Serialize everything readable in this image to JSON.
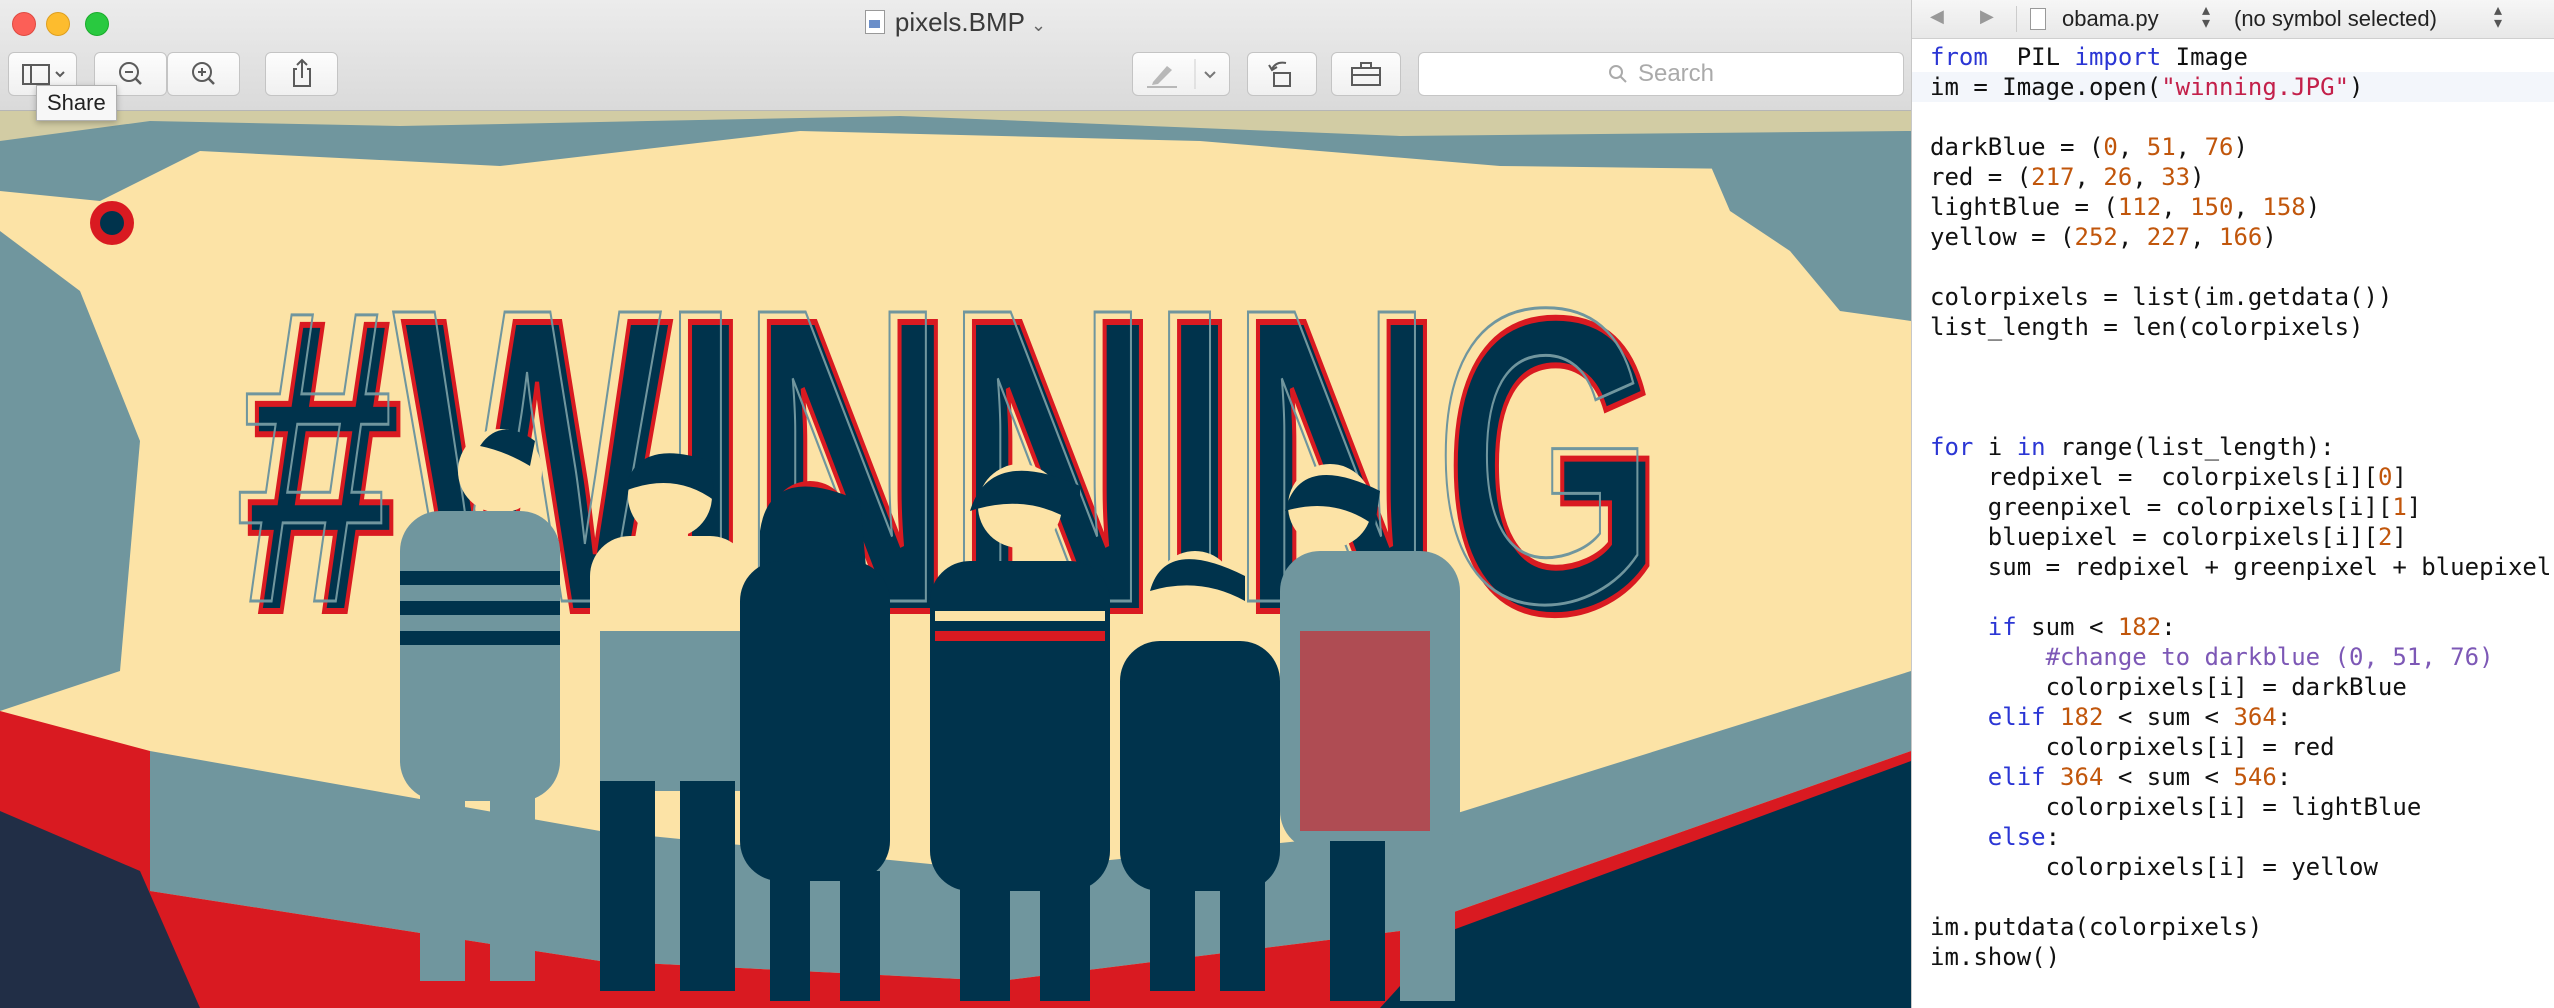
{
  "preview": {
    "title": "pixels.BMP",
    "tooltip": "Share",
    "search_placeholder": "Search",
    "image_text": "#WINNING",
    "palette": {
      "darkBlue": "#00334c",
      "red": "#d91a21",
      "lightBlue": "#70969e",
      "yellow": "#fce3a6"
    }
  },
  "editor": {
    "file_name": "obama.py",
    "symbol": "(no symbol selected)",
    "code_lines": [
      [
        [
          "kw",
          "from"
        ],
        [
          "",
          "  PIL "
        ],
        [
          "kw",
          "import"
        ],
        [
          "",
          " Image"
        ]
      ],
      [
        [
          "",
          "im = Image.open("
        ],
        [
          "str",
          "\"winning.JPG\""
        ],
        [
          "",
          ")"
        ]
      ],
      [],
      [
        [
          "",
          "darkBlue = ("
        ],
        [
          "num",
          "0"
        ],
        [
          "",
          ", "
        ],
        [
          "num",
          "51"
        ],
        [
          "",
          ", "
        ],
        [
          "num",
          "76"
        ],
        [
          "",
          ")"
        ]
      ],
      [
        [
          "",
          "red = ("
        ],
        [
          "num",
          "217"
        ],
        [
          "",
          ", "
        ],
        [
          "num",
          "26"
        ],
        [
          "",
          ", "
        ],
        [
          "num",
          "33"
        ],
        [
          "",
          ")"
        ]
      ],
      [
        [
          "",
          "lightBlue = ("
        ],
        [
          "num",
          "112"
        ],
        [
          "",
          ", "
        ],
        [
          "num",
          "150"
        ],
        [
          "",
          ", "
        ],
        [
          "num",
          "158"
        ],
        [
          "",
          ")"
        ]
      ],
      [
        [
          "",
          "yellow = ("
        ],
        [
          "num",
          "252"
        ],
        [
          "",
          ", "
        ],
        [
          "num",
          "227"
        ],
        [
          "",
          ", "
        ],
        [
          "num",
          "166"
        ],
        [
          "",
          ")"
        ]
      ],
      [],
      [
        [
          "",
          "colorpixels = list(im.getdata())"
        ]
      ],
      [
        [
          "",
          "list_length = len(colorpixels)"
        ]
      ],
      [],
      [],
      [],
      [
        [
          "kw",
          "for"
        ],
        [
          "",
          " i "
        ],
        [
          "kw",
          "in"
        ],
        [
          "",
          " range(list_length):"
        ]
      ],
      [
        [
          "",
          "    redpixel =  colorpixels[i]["
        ],
        [
          "num",
          "0"
        ],
        [
          "",
          "]"
        ]
      ],
      [
        [
          "",
          "    greenpixel = colorpixels[i]["
        ],
        [
          "num",
          "1"
        ],
        [
          "",
          "]"
        ]
      ],
      [
        [
          "",
          "    bluepixel = colorpixels[i]["
        ],
        [
          "num",
          "2"
        ],
        [
          "",
          "]"
        ]
      ],
      [
        [
          "",
          "    sum = redpixel + greenpixel + bluepixel"
        ]
      ],
      [],
      [
        [
          "",
          "    "
        ],
        [
          "kw",
          "if"
        ],
        [
          "",
          " sum < "
        ],
        [
          "num",
          "182"
        ],
        [
          "",
          ":"
        ]
      ],
      [
        [
          "",
          "        "
        ],
        [
          "cmt",
          "#change to darkblue (0, 51, 76)"
        ]
      ],
      [
        [
          "",
          "        colorpixels[i] = darkBlue"
        ]
      ],
      [
        [
          "",
          "    "
        ],
        [
          "kw",
          "elif"
        ],
        [
          " ",
          " "
        ],
        [
          "num",
          "182"
        ],
        [
          "",
          " < sum < "
        ],
        [
          "num",
          "364"
        ],
        [
          "",
          ":"
        ]
      ],
      [
        [
          "",
          "        colorpixels[i] = red"
        ]
      ],
      [
        [
          "",
          "    "
        ],
        [
          "kw",
          "elif"
        ],
        [
          "",
          " "
        ],
        [
          "num",
          "364"
        ],
        [
          "",
          " < sum < "
        ],
        [
          "num",
          "546"
        ],
        [
          "",
          ":"
        ]
      ],
      [
        [
          "",
          "        colorpixels[i] = lightBlue"
        ]
      ],
      [
        [
          "",
          "    "
        ],
        [
          "kw",
          "else"
        ],
        [
          "",
          ":"
        ]
      ],
      [
        [
          "",
          "        colorpixels[i] = yellow"
        ]
      ],
      [],
      [
        [
          "",
          "im.putdata(colorpixels)"
        ]
      ],
      [
        [
          "",
          "im.show()"
        ]
      ]
    ]
  }
}
